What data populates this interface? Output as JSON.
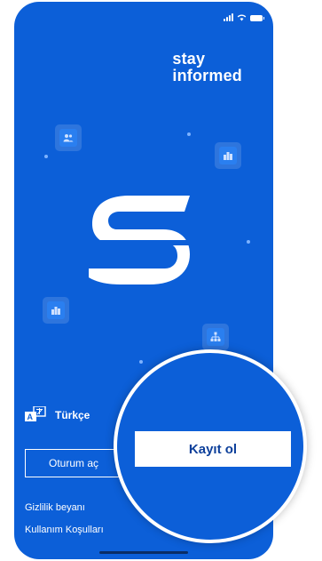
{
  "brand": {
    "line1": "stay",
    "line2": "informed"
  },
  "language": {
    "label": "Türkçe",
    "icon": "translate-icon"
  },
  "buttons": {
    "login_label": "Oturum aç",
    "signup_label": "Kayıt ol"
  },
  "footer": {
    "privacy_label": "Gizlilik beyanı",
    "terms_label": "Kullanım Koşulları"
  },
  "colors": {
    "primary_blue": "#0c5fd8",
    "tile_bg": "#2a7ff0",
    "button_text": "#0c3f9a"
  }
}
